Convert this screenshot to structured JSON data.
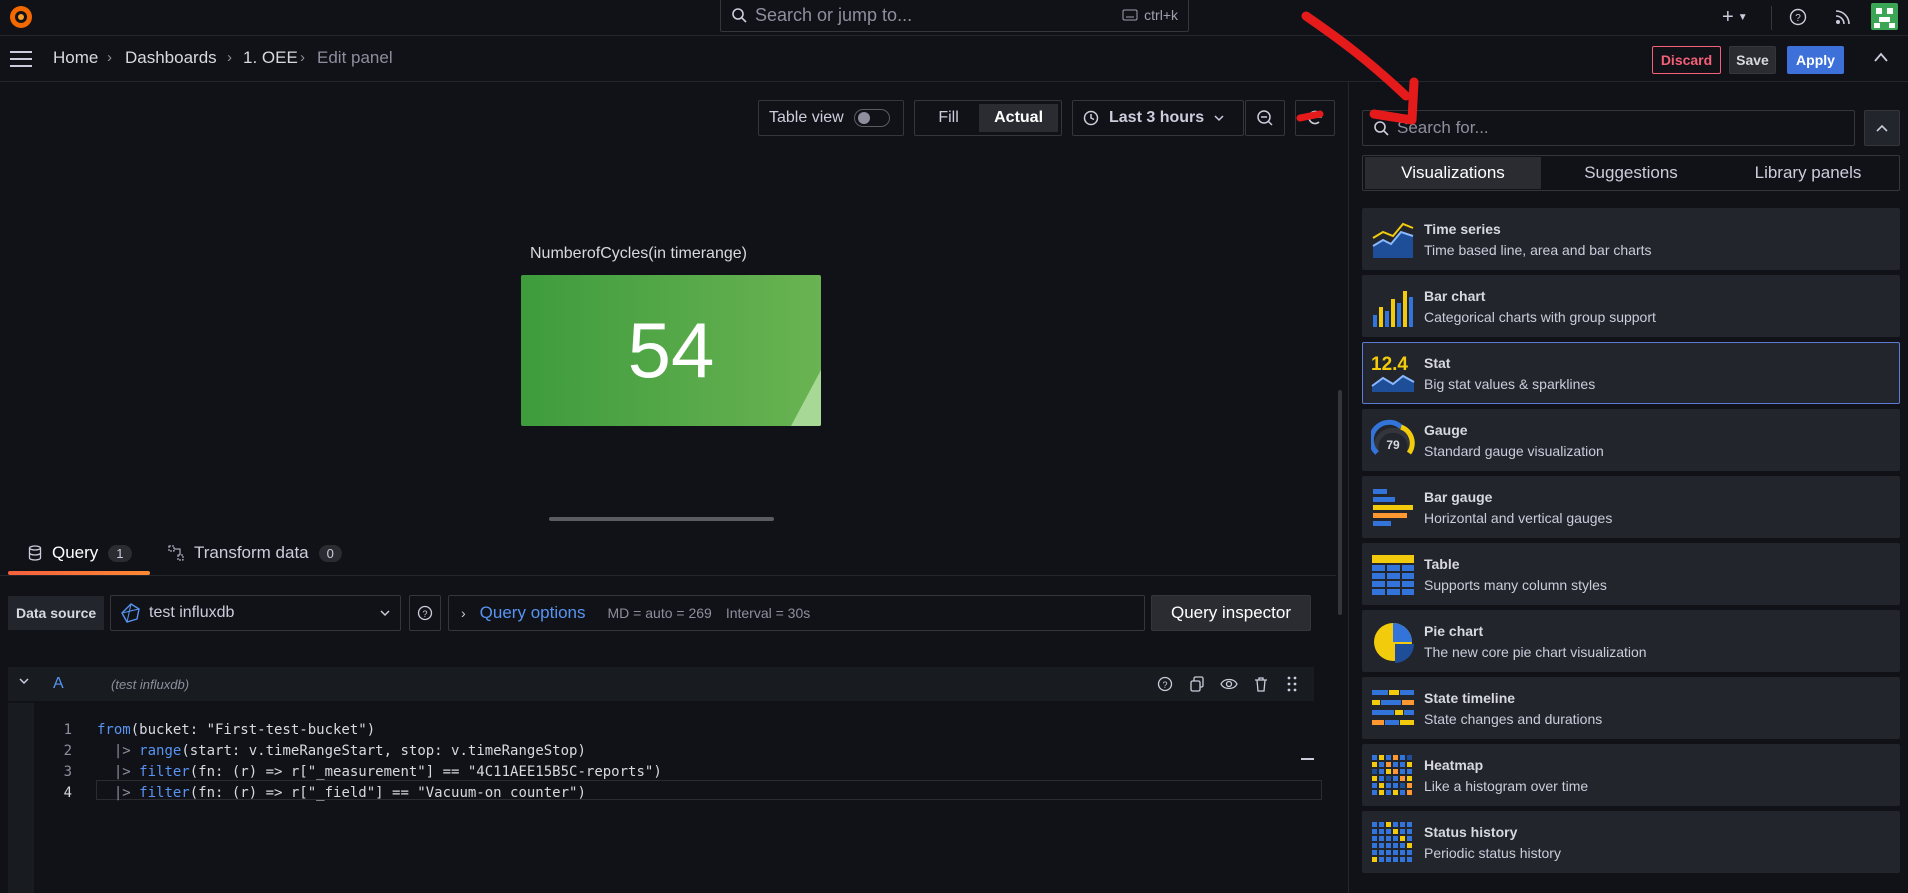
{
  "topbar": {
    "search_placeholder": "Search or jump to...",
    "search_shortcut": "ctrl+k"
  },
  "breadcrumb": {
    "items": [
      "Home",
      "Dashboards",
      "1. OEE",
      "Edit panel"
    ]
  },
  "actions": {
    "discard": "Discard",
    "save": "Save",
    "apply": "Apply"
  },
  "toolbar": {
    "table_view": "Table view",
    "fill": "Fill",
    "actual": "Actual",
    "time_range": "Last 3 hours"
  },
  "panel": {
    "title": "NumberofCycles(in timerange)",
    "value": "54",
    "color": "#56a64b"
  },
  "query_tabs": [
    {
      "label": "Query",
      "count": "1"
    },
    {
      "label": "Transform data",
      "count": "0"
    }
  ],
  "datasource": {
    "label": "Data source",
    "value": "test influxdb",
    "query_options": "Query options",
    "md": "MD = auto = 269",
    "interval": "Interval = 30s",
    "inspector": "Query inspector"
  },
  "query": {
    "ref": "A",
    "source": "(test influxdb)",
    "lines": [
      {
        "n": "1",
        "kw": "from",
        "rest": "(bucket: \"First-test-bucket\")",
        "prefix": ""
      },
      {
        "n": "2",
        "kw": "range",
        "rest": "(start: v.timeRangeStart, stop: v.timeRangeStop)",
        "prefix": "  |> "
      },
      {
        "n": "3",
        "kw": "filter",
        "rest": "(fn: (r) => r[\"_measurement\"] == \"4C11AEE15B5C-reports\")",
        "prefix": "  |> "
      },
      {
        "n": "4",
        "kw": "filter",
        "rest": "(fn: (r) => r[\"_field\"] == \"Vacuum-on counter\")",
        "prefix": "  |> "
      }
    ]
  },
  "right_panel": {
    "search_placeholder": "Search for...",
    "tabs": [
      "Visualizations",
      "Suggestions",
      "Library panels"
    ],
    "visualizations": [
      {
        "title": "Time series",
        "desc": "Time based line, area and bar charts",
        "icon": "time-series-icon"
      },
      {
        "title": "Bar chart",
        "desc": "Categorical charts with group support",
        "icon": "bar-chart-icon"
      },
      {
        "title": "Stat",
        "desc": "Big stat values & sparklines",
        "icon": "stat-icon",
        "stat_value": "12.4"
      },
      {
        "title": "Gauge",
        "desc": "Standard gauge visualization",
        "icon": "gauge-icon",
        "gauge_value": "79"
      },
      {
        "title": "Bar gauge",
        "desc": "Horizontal and vertical gauges",
        "icon": "bar-gauge-icon"
      },
      {
        "title": "Table",
        "desc": "Supports many column styles",
        "icon": "table-icon"
      },
      {
        "title": "Pie chart",
        "desc": "The new core pie chart visualization",
        "icon": "pie-chart-icon"
      },
      {
        "title": "State timeline",
        "desc": "State changes and durations",
        "icon": "state-timeline-icon"
      },
      {
        "title": "Heatmap",
        "desc": "Like a histogram over time",
        "icon": "heatmap-icon"
      },
      {
        "title": "Status history",
        "desc": "Periodic status history",
        "icon": "status-history-icon"
      }
    ]
  },
  "colors": {
    "accent": "#3d71d9",
    "discard": "#f55f78",
    "selected_border": "#5b7bd5",
    "annotation_arrow": "#e51b1b"
  }
}
